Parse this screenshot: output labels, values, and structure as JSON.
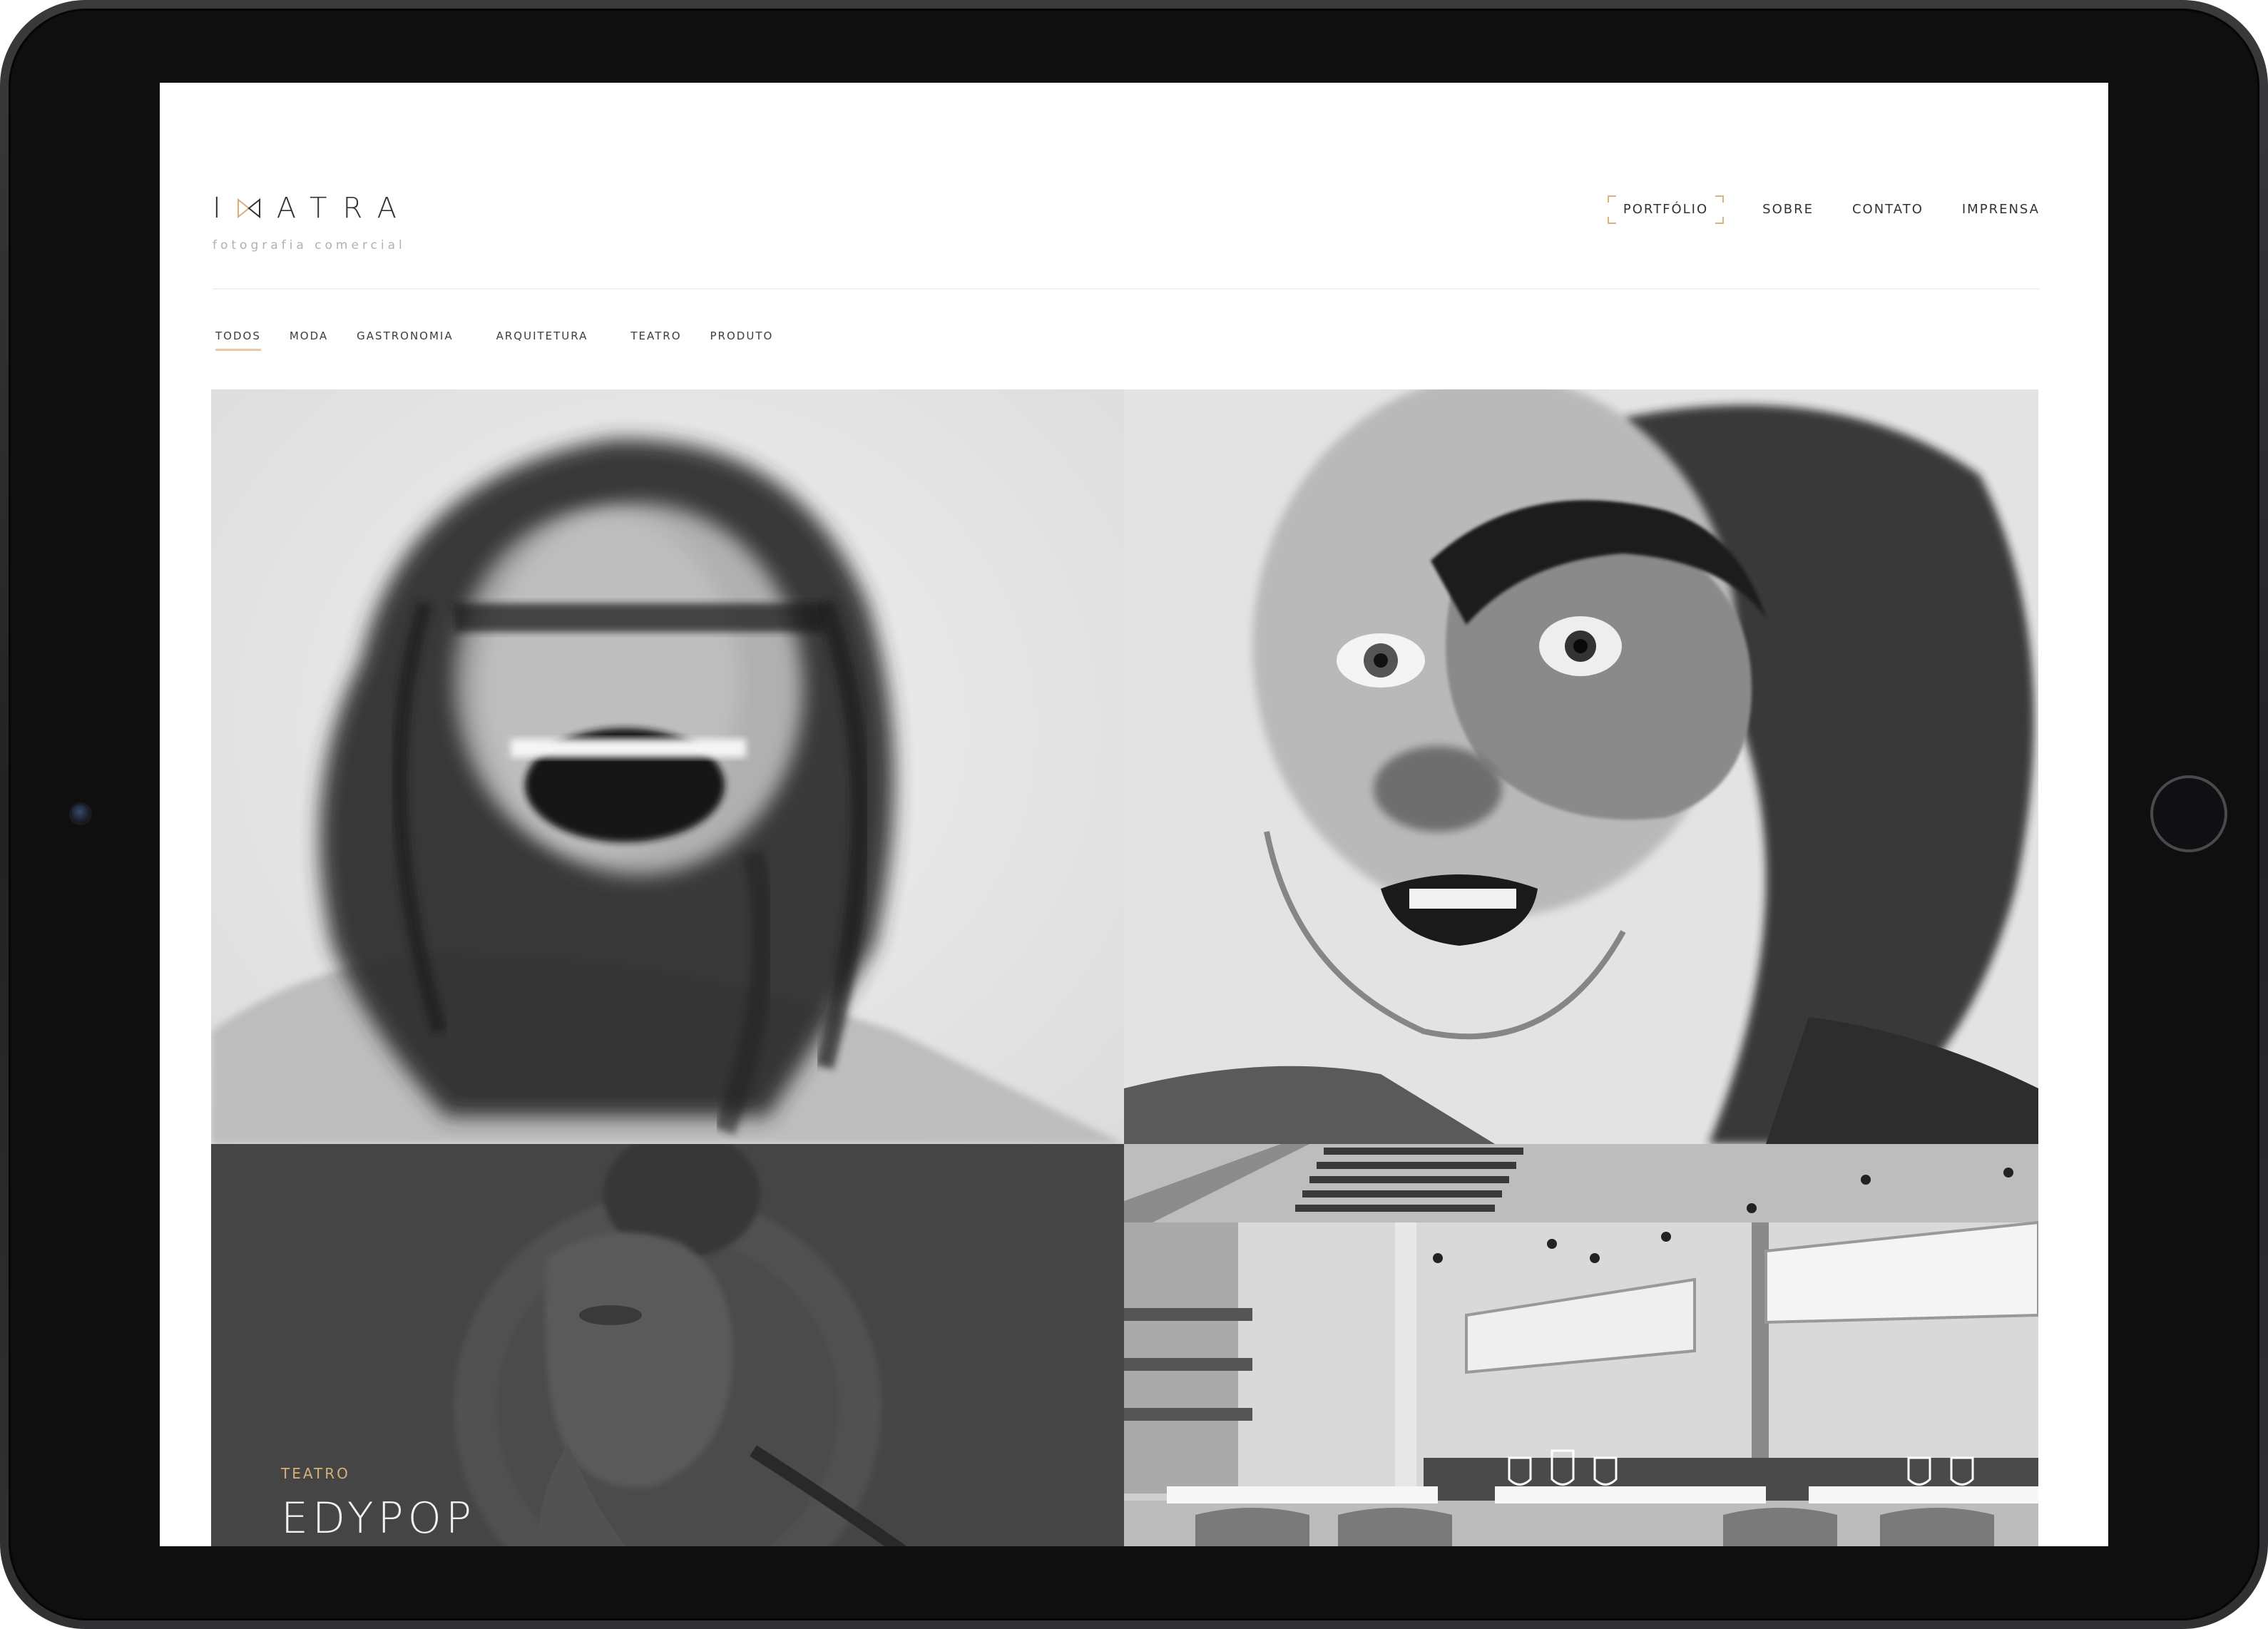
{
  "brand": {
    "logo_text": "ATRA",
    "logo_prefix": "I",
    "tagline": "fotografia comercial"
  },
  "main_nav": {
    "items": [
      {
        "label": "PORTFÓLIO",
        "active": true
      },
      {
        "label": "SOBRE",
        "active": false
      },
      {
        "label": "CONTATO",
        "active": false
      },
      {
        "label": "IMPRENSA",
        "active": false
      }
    ]
  },
  "filters": {
    "items": [
      {
        "label": "TODOS",
        "active": true
      },
      {
        "label": "MODA",
        "active": false
      },
      {
        "label": "GASTRONOMIA",
        "active": false
      },
      {
        "label": "ARQUITETURA",
        "active": false
      },
      {
        "label": "TEATRO",
        "active": false
      },
      {
        "label": "PRODUTO",
        "active": false
      }
    ]
  },
  "portfolio": {
    "tiles": [
      {
        "image": "woman-screaming-bw-photo"
      },
      {
        "image": "man-double-exposure-bw-photo"
      },
      {
        "image": "woman-profile-double-exposure-photo",
        "category": "TEATRO",
        "title": "EDYPOP"
      },
      {
        "image": "restaurant-interior-bw-photo"
      }
    ]
  },
  "colors": {
    "accent": "#d6b07a",
    "text": "#333333",
    "muted": "#b1b1b1",
    "device_bezel": "#0f0f10"
  }
}
